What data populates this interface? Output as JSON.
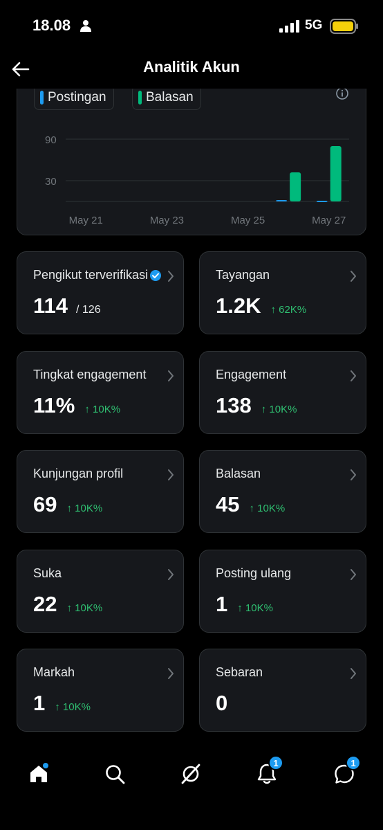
{
  "status_bar": {
    "time": "18.08",
    "network": "5G"
  },
  "header": {
    "title": "Analitik Akun"
  },
  "chart": {
    "legend": [
      {
        "label": "Postingan",
        "color": "#1d9bf0"
      },
      {
        "label": "Balasan",
        "color": "#00ba7c"
      }
    ]
  },
  "chart_data": {
    "type": "bar",
    "categories": [
      "May 21",
      "May 22",
      "May 23",
      "May 24",
      "May 25",
      "May 26",
      "May 27"
    ],
    "tick_labels": [
      "May 21",
      "May 23",
      "May 25",
      "May 27"
    ],
    "series": [
      {
        "name": "Postingan",
        "color": "#1d9bf0",
        "values": [
          0,
          0,
          0,
          0,
          0,
          2,
          1
        ]
      },
      {
        "name": "Balasan",
        "color": "#00ba7c",
        "values": [
          0,
          0,
          0,
          0,
          0,
          42,
          80
        ]
      }
    ],
    "y_ticks": [
      30,
      90
    ],
    "ylim": [
      0,
      100
    ],
    "grid": true,
    "legend_position": "top-left"
  },
  "stats": [
    {
      "label": "Pengikut terverifikasi",
      "value": "114",
      "total": "/ 126",
      "change": "",
      "verified": true
    },
    {
      "label": "Tayangan",
      "value": "1.2K",
      "change": "↑ 62K%"
    },
    {
      "label": "Tingkat engagement",
      "value": "11%",
      "change": "↑ 10K%"
    },
    {
      "label": "Engagement",
      "value": "138",
      "change": "↑ 10K%"
    },
    {
      "label": "Kunjungan profil",
      "value": "69",
      "change": "↑ 10K%"
    },
    {
      "label": "Balasan",
      "value": "45",
      "change": "↑ 10K%"
    },
    {
      "label": "Suka",
      "value": "22",
      "change": "↑ 10K%"
    },
    {
      "label": "Posting ulang",
      "value": "1",
      "change": "↑ 10K%"
    },
    {
      "label": "Markah",
      "value": "1",
      "change": "↑ 10K%"
    },
    {
      "label": "Sebaran",
      "value": "0",
      "change": ""
    }
  ],
  "bottom_nav": {
    "items": [
      {
        "icon": "home-icon",
        "badge": ""
      },
      {
        "icon": "search-icon",
        "badge": ""
      },
      {
        "icon": "grok-icon",
        "badge": ""
      },
      {
        "icon": "bell-icon",
        "badge": "1"
      },
      {
        "icon": "messages-icon",
        "badge": "1"
      }
    ]
  }
}
